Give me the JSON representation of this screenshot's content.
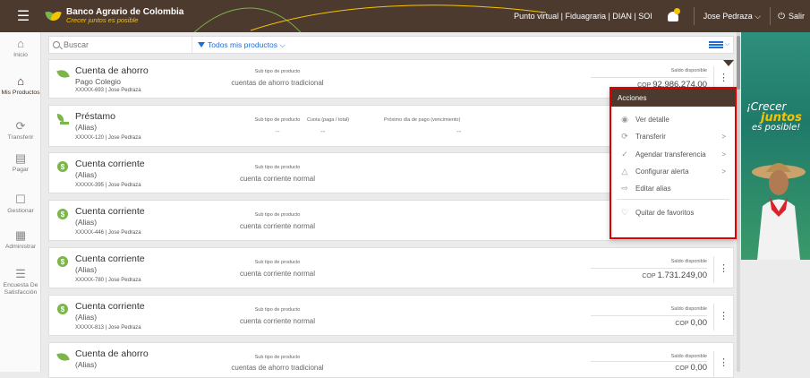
{
  "header": {
    "bank_name": "Banco Agrario de Colombia",
    "slogan": "Crecer juntos es posible",
    "links": "Punto virtual | Fiduagraria | DIAN | SOI",
    "user": "Jose Pedraza ⌵",
    "logout": "Salir"
  },
  "nav": [
    {
      "label": "Inicio",
      "icon": "⌂"
    },
    {
      "label": "Mis Productos",
      "icon": "⌂"
    },
    {
      "label": "Transferir",
      "icon": "⟳"
    },
    {
      "label": "Pagar",
      "icon": "▤"
    },
    {
      "label": "Gestionar",
      "icon": "☐"
    },
    {
      "label": "Administrar",
      "icon": "▦"
    },
    {
      "label": "Encuesta De Satisfacción",
      "icon": "☰"
    }
  ],
  "toolbar": {
    "search_placeholder": "Buscar",
    "filter_label": "Todos mis productos ⌵"
  },
  "labels": {
    "subtype": "Sub tipo de producto",
    "balance": "Saldo disponible",
    "currency": "COP",
    "cuota": "Cuota (paga / total)",
    "next_payment": "Próximo día de pago (vencimiento)",
    "dash": "--"
  },
  "products": [
    {
      "name": "Cuenta de ahorro",
      "alias": "Pago Colegio",
      "account": "XXXXX-693 | Jose Pedraza",
      "subtype": "cuentas de ahorro tradicional",
      "balance": "92.986.274,00"
    },
    {
      "name": "Préstamo",
      "alias": "(Alias)",
      "account": "XXXXX-120 | Jose Pedraza",
      "subtype": "--"
    },
    {
      "name": "Cuenta corriente",
      "alias": "(Alias)",
      "account": "XXXXX-395 | Jose Pedraza",
      "subtype": "cuenta corriente normal"
    },
    {
      "name": "Cuenta corriente",
      "alias": "(Alias)",
      "account": "XXXXX-446 | Jose Pedraza",
      "subtype": "cuenta corriente normal"
    },
    {
      "name": "Cuenta corriente",
      "alias": "(Alias)",
      "account": "XXXXX-780 | Jose Pedraza",
      "subtype": "cuenta corriente normal",
      "balance": "1.731.249,00"
    },
    {
      "name": "Cuenta corriente",
      "alias": "(Alias)",
      "account": "XXXXX-813 | Jose Pedraza",
      "subtype": "cuenta corriente normal",
      "balance": "0,00"
    },
    {
      "name": "Cuenta de ahorro",
      "alias": "(Alias)",
      "account": "",
      "subtype": "cuentas de ahorro tradicional",
      "balance": "0,00"
    }
  ],
  "menu": {
    "title": "Acciones",
    "items": [
      {
        "label": "Ver detalle",
        "icon": "eye-icon"
      },
      {
        "label": "Transferir",
        "icon": "transfer-icon"
      },
      {
        "label": "Agendar transferencia",
        "icon": "schedule-icon"
      },
      {
        "label": "Configurar alerta",
        "icon": "bell-icon"
      },
      {
        "label": "Editar alias",
        "icon": "edit-icon"
      },
      {
        "label": "Quitar de favoritos",
        "icon": "unfavorite-icon"
      }
    ]
  },
  "banner": {
    "line1": "¡Crecer",
    "line2": "juntos",
    "line3": "es posible!"
  },
  "colors": {
    "header_bg": "#4d3a2e",
    "accent_green": "#7ab648",
    "accent_yellow": "#f5c400",
    "link_blue": "#1e6fd9",
    "highlight_red": "#e00000"
  }
}
